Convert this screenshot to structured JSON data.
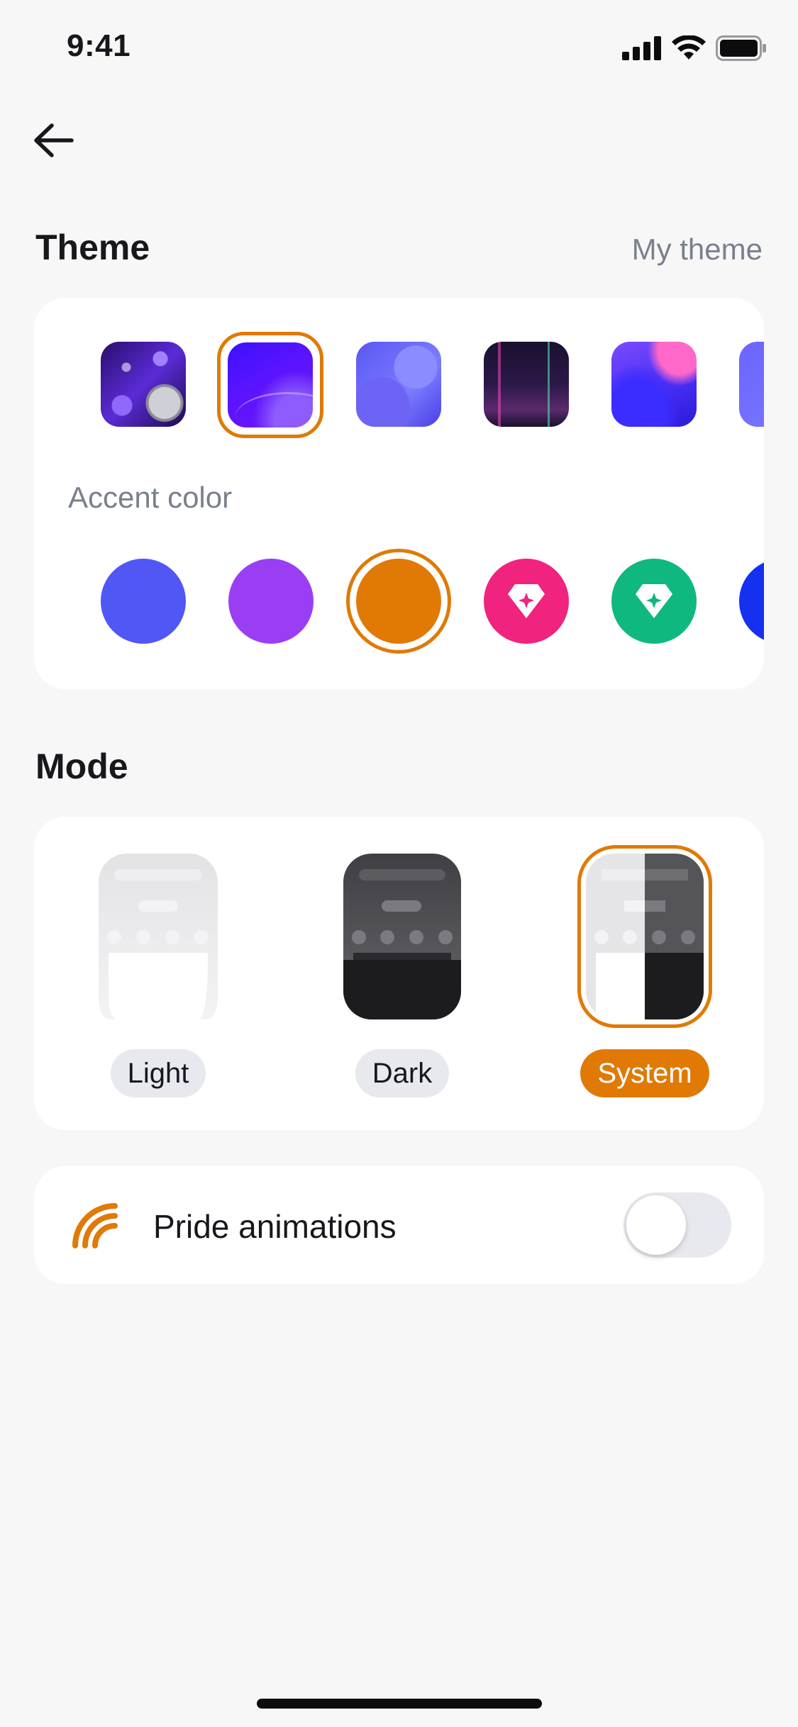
{
  "status_bar": {
    "time": "9:41"
  },
  "header": {
    "back_icon": "arrow-left-icon"
  },
  "theme": {
    "title": "Theme",
    "my_theme_link": "My theme",
    "wallpapers_selected_index": 1,
    "accent_label": "Accent color",
    "accent_colors": [
      "#5057f5",
      "#9a3ef3",
      "#e07a05",
      "#f0237f",
      "#0fb87f",
      "#1530f0"
    ],
    "accent_selected_index": 2,
    "accent_icons": {
      "premium": "gem-sparkle-icon"
    }
  },
  "mode": {
    "title": "Mode",
    "options": [
      {
        "label": "Light"
      },
      {
        "label": "Dark"
      },
      {
        "label": "System"
      }
    ],
    "selected": "System"
  },
  "pride": {
    "label": "Pride animations",
    "icon": "rainbow-icon",
    "enabled": false
  },
  "colors": {
    "accent": "#e07a05",
    "background": "#f7f7f8",
    "card": "#ffffff",
    "muted_text": "#7a808c"
  }
}
